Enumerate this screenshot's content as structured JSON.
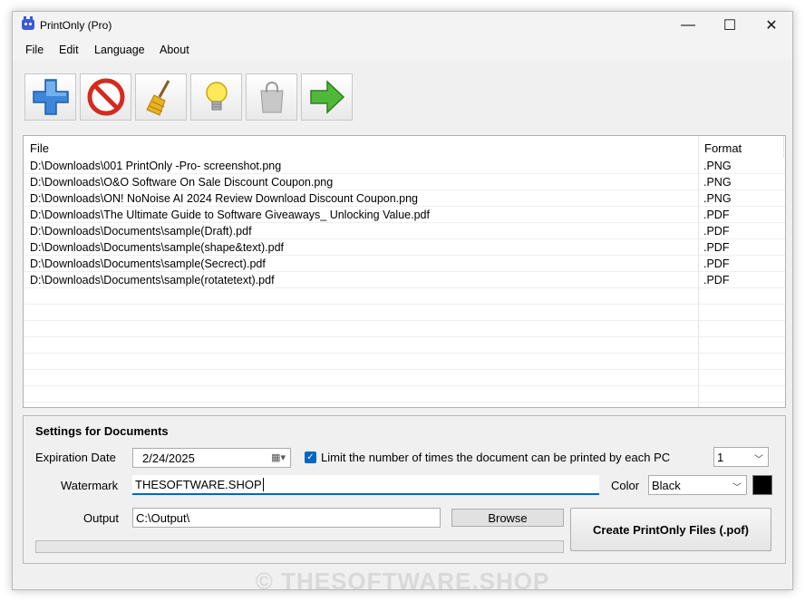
{
  "window": {
    "title": "PrintOnly (Pro)"
  },
  "window_controls": {
    "minimize": "—",
    "maximize": "☐",
    "close": "✕"
  },
  "menu": [
    "File",
    "Edit",
    "Language",
    "About"
  ],
  "toolbar": {
    "buttons": [
      {
        "icon": "add-icon"
      },
      {
        "icon": "remove-icon"
      },
      {
        "icon": "clear-broom-icon"
      },
      {
        "icon": "lightbulb-icon"
      },
      {
        "icon": "shopping-bag-icon"
      },
      {
        "icon": "arrow-right-icon"
      }
    ]
  },
  "filelist": {
    "columns": [
      "File",
      "Format"
    ],
    "rows": [
      {
        "file": "D:\\Downloads\\001 PrintOnly -Pro- screenshot.png",
        "format": ".PNG"
      },
      {
        "file": "D:\\Downloads\\O&O Software On Sale Discount Coupon.png",
        "format": ".PNG"
      },
      {
        "file": "D:\\Downloads\\ON! NoNoise AI 2024 Review Download Discount Coupon.png",
        "format": ".PNG"
      },
      {
        "file": "D:\\Downloads\\The Ultimate Guide to Software Giveaways_ Unlocking Value.pdf",
        "format": ".PDF"
      },
      {
        "file": "D:\\Downloads\\Documents\\sample(Draft).pdf",
        "format": ".PDF"
      },
      {
        "file": "D:\\Downloads\\Documents\\sample(shape&text).pdf",
        "format": ".PDF"
      },
      {
        "file": "D:\\Downloads\\Documents\\sample(Secrect).pdf",
        "format": ".PDF"
      },
      {
        "file": "D:\\Downloads\\Documents\\sample(rotatetext).pdf",
        "format": ".PDF"
      }
    ]
  },
  "settings": {
    "heading": "Settings for Documents",
    "expiration_label": "Expiration Date",
    "expiration_value": "2/24/2025",
    "limit_label": "Limit the number of times the document can be printed by each PC",
    "limit_value": "1",
    "watermark_label": "Watermark",
    "watermark_value": "THESOFTWARE.SHOP",
    "color_label": "Color",
    "color_value": "Black",
    "swatch_color": "#000000",
    "output_label": "Output",
    "output_value": "C:\\Output\\",
    "browse_label": "Browse",
    "create_label": "Create PrintOnly Files (.pof)"
  },
  "watermark_overlay": "© THESOFTWARE.SHOP"
}
